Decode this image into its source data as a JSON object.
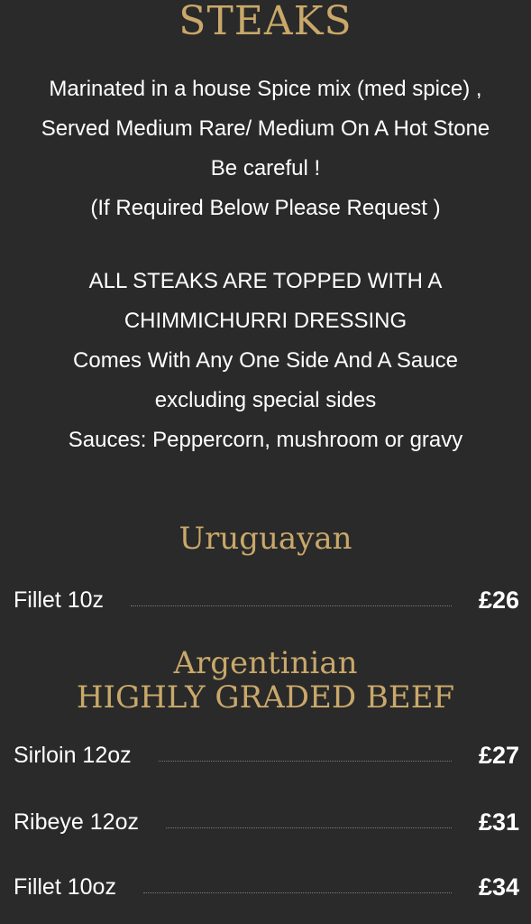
{
  "title": "STEAKS",
  "intro_top": [
    "Marinated in a house Spice mix (med spice) ,",
    "Served Medium Rare/ Medium On A Hot Stone",
    "Be careful !",
    "(If Required Below Please Request )"
  ],
  "intro_bottom": [
    "ALL STEAKS ARE TOPPED WITH A",
    "CHIMMICHURRI DRESSING",
    "Comes With Any One Side And A Sauce",
    "excluding special sides",
    "Sauces: Peppercorn, mushroom or gravy"
  ],
  "sections": [
    {
      "heading": [
        "Uruguayan"
      ],
      "items": [
        {
          "name": "Fillet 10z",
          "price": "£26"
        }
      ]
    },
    {
      "heading": [
        "Argentinian",
        "HIGHLY GRADED BEEF"
      ],
      "items": [
        {
          "name": "Sirloin 12oz",
          "price": "£27"
        },
        {
          "name": "Ribeye 12oz",
          "price": "£31"
        },
        {
          "name": "Fillet 10oz",
          "price": "£34"
        }
      ]
    }
  ],
  "colors": {
    "background": "#2a2a2a",
    "accent_gold": "#c9a86a",
    "text": "#ffffff"
  }
}
